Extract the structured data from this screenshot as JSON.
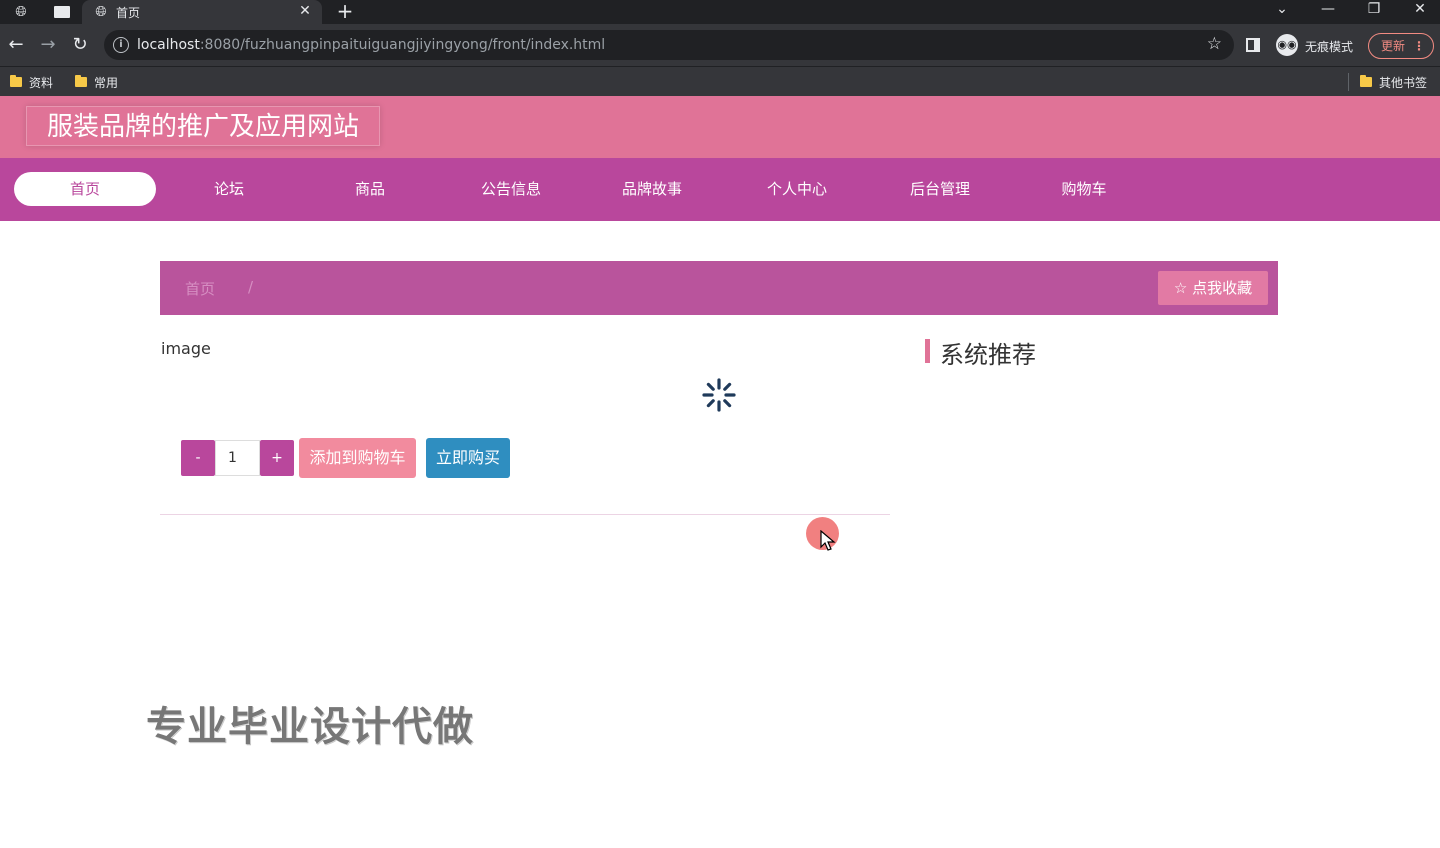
{
  "browser": {
    "tab_title": "首页",
    "new_tab": "+",
    "url_host": "localhost",
    "url_rest": ":8080/fuzhuangpinpaituiguangjiyingyong/front/index.html",
    "incognito_label": "无痕模式",
    "update_label": "更新",
    "bookmarks": [
      "资料",
      "常用"
    ],
    "other_bookmarks": "其他书签",
    "icons": {
      "back": "back-arrow-icon",
      "forward": "forward-arrow-icon",
      "reload": "reload-icon",
      "info": "info-icon",
      "star": "star-icon"
    }
  },
  "site": {
    "title": "服装品牌的推广及应用网站",
    "nav": [
      "首页",
      "论坛",
      "商品",
      "公告信息",
      "品牌故事",
      "个人中心",
      "后台管理",
      "购物车"
    ],
    "active_nav": "首页",
    "breadcrumb": {
      "home": "首页",
      "separator": "/"
    },
    "favorite_label": "点我收藏",
    "image_alt": "image",
    "quantity": "1",
    "minus_label": "-",
    "plus_label": "+",
    "add_to_cart_label": "添加到购物车",
    "buy_now_label": "立即购买",
    "recommend_title": "系统推荐",
    "watermark": "专业毕业设计代做"
  },
  "colors": {
    "header": "#e07397",
    "nav": "#b9479c",
    "breadcrumb_bar": "#b9549c",
    "cart_button": "#f28b9e",
    "buy_button": "#2f8ec0"
  }
}
